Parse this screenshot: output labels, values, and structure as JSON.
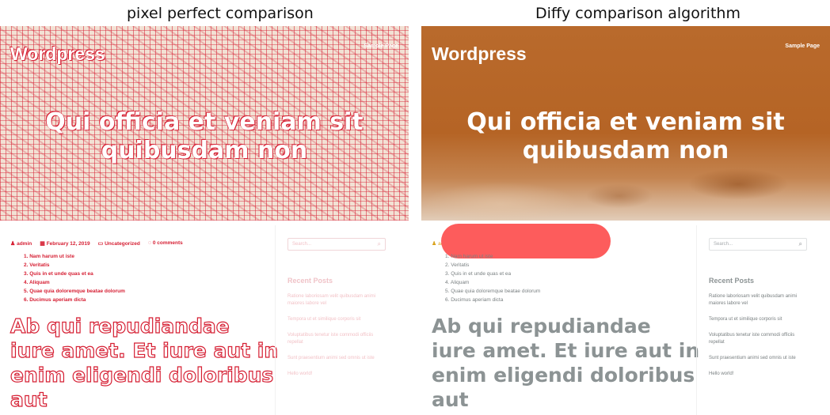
{
  "captions": {
    "left": "pixel perfect comparison",
    "right": "Diffy comparison algorithm"
  },
  "page": {
    "site_title": "Wordpress",
    "nav_item": "Sample Page",
    "hero_title": "Qui officia et veniam sit quibusdam non",
    "meta": {
      "author": "admin",
      "date": "February 12, 2019",
      "category": "Uncategorized",
      "comments": "0 comments"
    },
    "list_items": [
      "1. Nam harum ut iste",
      "2. Veritatis",
      "3. Quis in et unde quas et ea",
      "4. Aliquam",
      "5. Quae quia doloremque beatae dolorum",
      "6. Ducimus aperiam dicta"
    ],
    "headline": "Ab qui repudiandae iure amet. Et iure aut in enim eligendi doloribus aut",
    "search_placeholder": "Search...",
    "recent_posts_title": "Recent Posts",
    "recent_posts": [
      "Ratione laboriosam velit quibusdam animi maiores labore vel",
      "Tempora ut et similique corporis sit",
      "Voluptatibus tenetur iste commodi officiis repellat",
      "Sunt praesentium animi sed omnis ut iste",
      "Hello world!"
    ]
  },
  "colors": {
    "diff_red": "#d62034",
    "hero_orange": "#b56425",
    "accent_yellow": "#d9a21b",
    "redaction": "#fd5c5c",
    "headline_gray": "#8c9394"
  },
  "icons": {
    "author": "person-icon",
    "date": "calendar-icon",
    "category": "folder-icon",
    "comments": "comment-icon",
    "search": "search-icon"
  }
}
